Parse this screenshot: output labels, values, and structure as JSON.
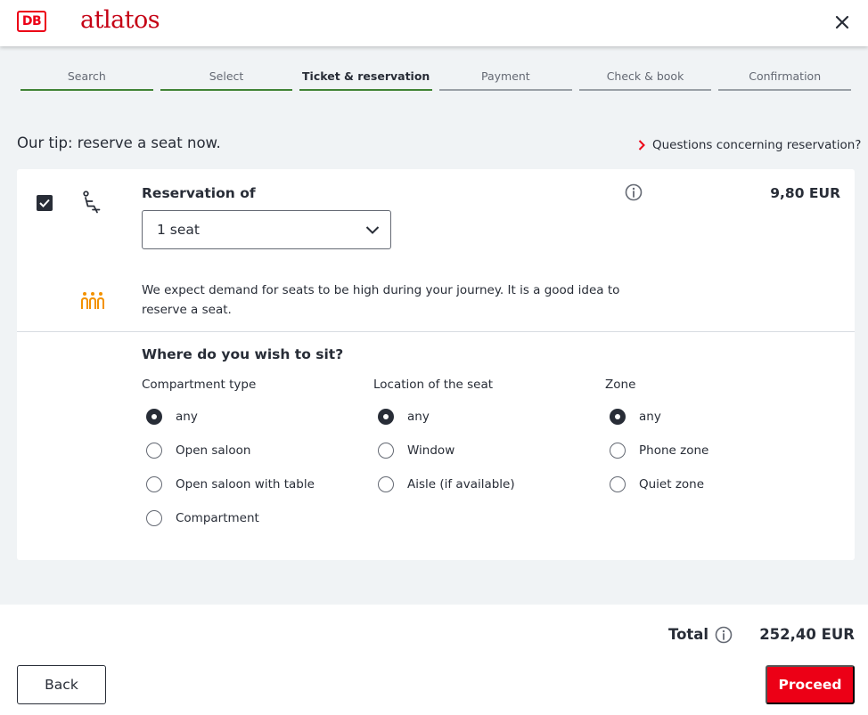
{
  "header": {
    "logo_text": "DB",
    "brand": "atlatos",
    "close_icon": "close-icon",
    "brand_color": "#c50014",
    "logo_color": "#ec0016"
  },
  "steps": [
    {
      "label": "Search",
      "state": "done"
    },
    {
      "label": "Select",
      "state": "done"
    },
    {
      "label": "Ticket & reservation",
      "state": "active"
    },
    {
      "label": "Payment",
      "state": "pending"
    },
    {
      "label": "Check & book",
      "state": "pending"
    },
    {
      "label": "Confirmation",
      "state": "pending"
    }
  ],
  "tip": "Our tip: reserve a seat now.",
  "faq_link": "Questions concerning reservation?",
  "reservation": {
    "checked": true,
    "title": "Reservation of",
    "selected_option": "1 seat",
    "price": "9,80 EUR",
    "demand_text": "We expect demand for seats to be high during your journey. It is a good idea to reserve a seat.",
    "demand_color": "#f39200"
  },
  "preferences": {
    "title": "Where do you wish to sit?",
    "columns": [
      {
        "heading": "Compartment type",
        "options": [
          "any",
          "Open saloon",
          "Open saloon with table",
          "Compartment"
        ],
        "selected": 0
      },
      {
        "heading": "Location of the seat",
        "options": [
          "any",
          "Window",
          "Aisle (if available)"
        ],
        "selected": 0
      },
      {
        "heading": "Zone",
        "options": [
          "any",
          "Phone zone",
          "Quiet zone"
        ],
        "selected": 0
      }
    ]
  },
  "footer": {
    "total_label": "Total",
    "total_value": "252,40 EUR",
    "back_label": "Back",
    "proceed_label": "Proceed",
    "proceed_color": "#ec0016"
  }
}
